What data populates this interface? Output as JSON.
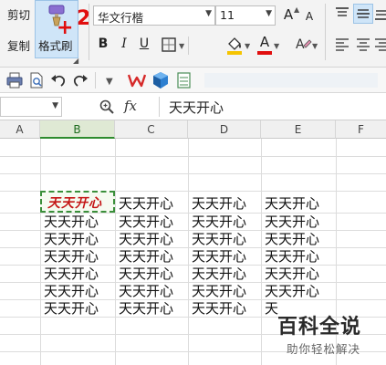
{
  "ribbon": {
    "cut_label": "剪切",
    "copy_label": "复制",
    "format_painter_label": "格式刷",
    "annotation_plus": "+",
    "annotation_step": "2",
    "font_name": "华文行楷",
    "font_size": "11",
    "increase_font_label": "A",
    "decrease_font_label": "A",
    "bold_label": "B",
    "italic_label": "I",
    "underline_label": "U",
    "font_color_label": "A",
    "accent_red": "#e10e0e",
    "highlight_yellow": "#f5c400"
  },
  "formula_bar": {
    "name_box": "",
    "fx_label": "fx",
    "content": "天天开心"
  },
  "columns": [
    "A",
    "B",
    "C",
    "D",
    "E",
    "F"
  ],
  "active_column": "B",
  "selected_cell": {
    "text": "天天开心",
    "text_color": "#c41515",
    "border_color": "#3a8f3a"
  },
  "grid": {
    "rows": [
      [
        "",
        "天天开心",
        "天天开心",
        "天天开心"
      ],
      [
        "天天开心",
        "天天开心",
        "天天开心",
        "天天开心"
      ],
      [
        "天天开心",
        "天天开心",
        "天天开心",
        "天天开心"
      ],
      [
        "天天开心",
        "天天开心",
        "天天开心",
        "天天开心"
      ],
      [
        "天天开心",
        "天天开心",
        "天天开心",
        "天天开心"
      ],
      [
        "天天开心",
        "天天开心",
        "天天开心",
        "天天开心"
      ],
      [
        "天天开心",
        "天天开心",
        "天天开心",
        "天"
      ]
    ]
  },
  "watermark": {
    "logo": "百科全说",
    "subtitle": "助你轻松解决"
  }
}
